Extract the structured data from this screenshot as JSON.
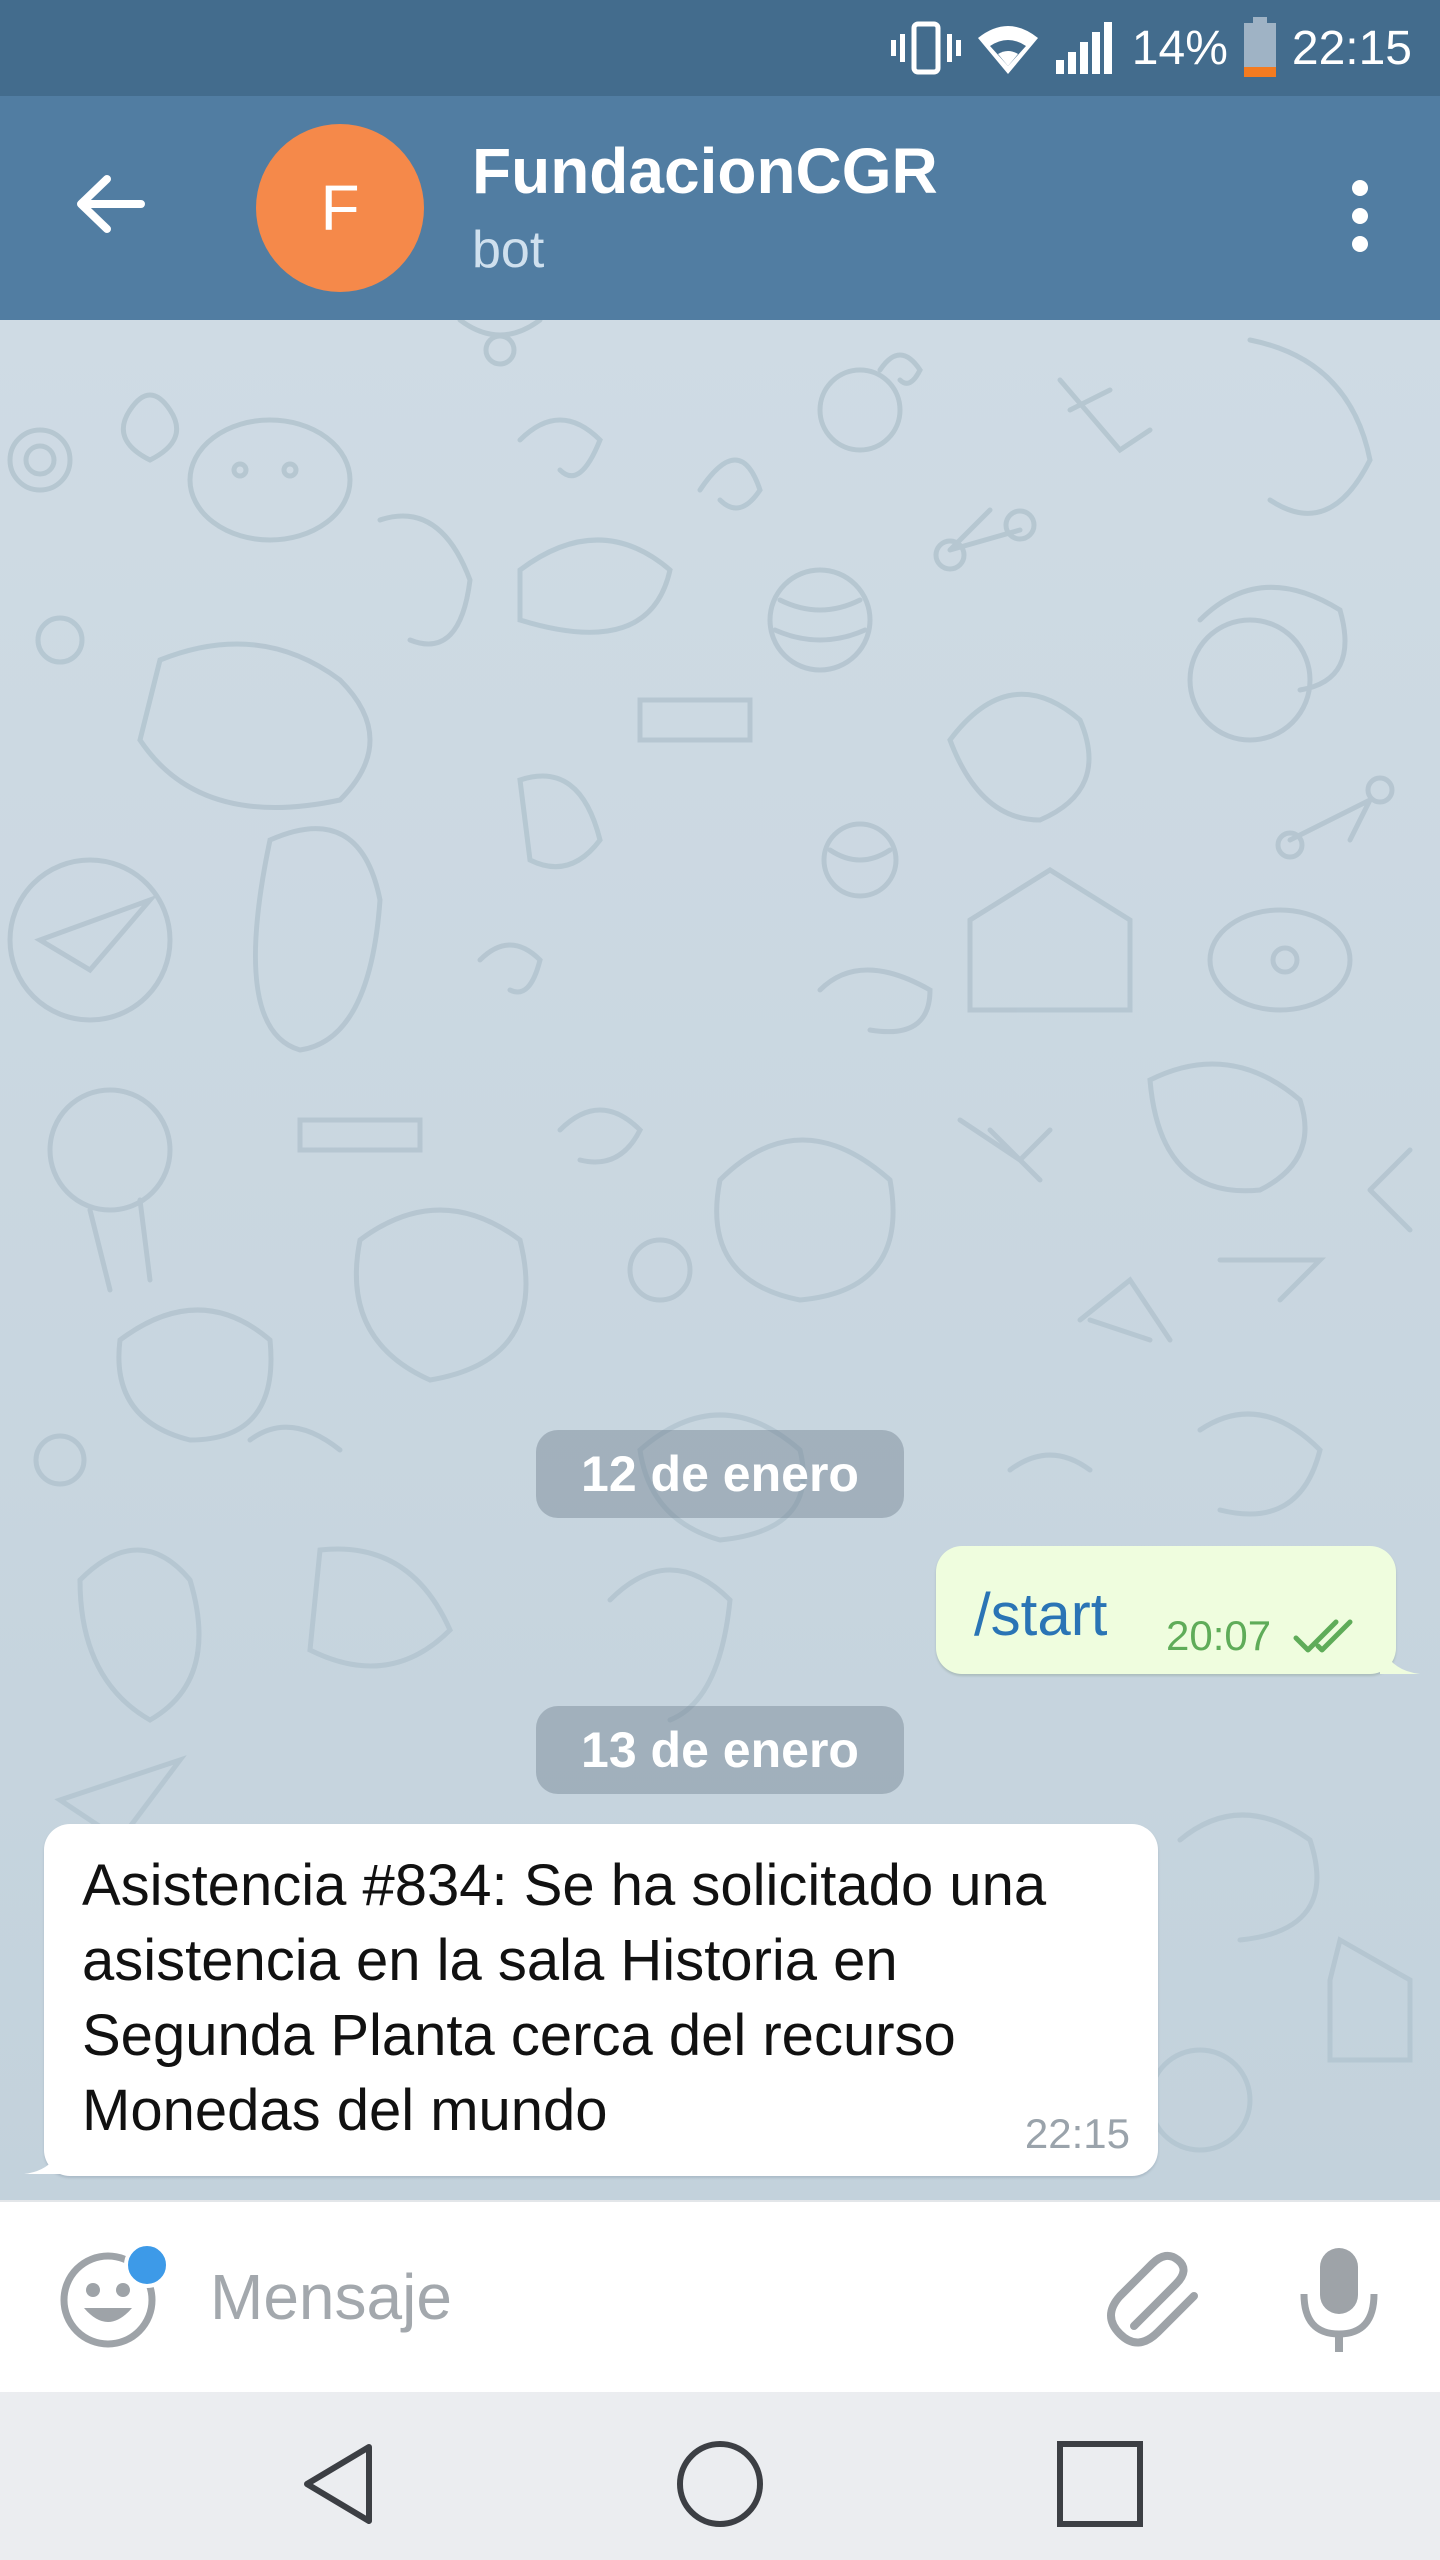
{
  "status_bar": {
    "battery_percent": "14%",
    "time": "22:15",
    "icons": [
      "vibrate-icon",
      "wifi-icon",
      "signal-icon",
      "battery-icon"
    ]
  },
  "header": {
    "avatar_letter": "F",
    "avatar_color": "#f5894a",
    "title": "FundacionCGR",
    "subtitle": "bot",
    "bar_color": "#517da2"
  },
  "chat": {
    "date_1": "12 de enero",
    "outgoing": {
      "text": "/start",
      "time": "20:07",
      "status": "read"
    },
    "date_2": "13 de enero",
    "incoming": {
      "text": "Asistencia #834: Se ha solicitado una asistencia en la sala Historia en Segunda Planta cerca del recurso Monedas del mundo",
      "time": "22:15"
    }
  },
  "composer": {
    "placeholder": "Mensaje"
  },
  "colors": {
    "status_bar": "#436c8d",
    "outgoing_bubble": "#effdde",
    "incoming_bubble": "#ffffff",
    "link_blue": "#2a74b5",
    "check_green": "#5fac59"
  }
}
